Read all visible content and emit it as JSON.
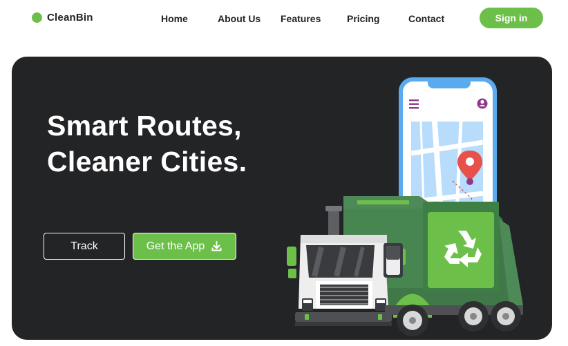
{
  "brand": {
    "name": "CleanBin",
    "accent": "#6cc04a"
  },
  "nav": {
    "links": [
      {
        "label": "Home"
      },
      {
        "label": "About Us"
      },
      {
        "label": "Features"
      },
      {
        "label": "Pricing"
      },
      {
        "label": "Contact"
      }
    ],
    "signin_label": "Sign in"
  },
  "hero": {
    "headline_line1": "Smart Routes,",
    "headline_line2": "Cleaner Cities.",
    "track_label": "Track",
    "app_label": "Get the App",
    "app_icon": "download-icon",
    "background": "#232426"
  },
  "illustration": {
    "phone_icons": [
      "menu-icon",
      "user-icon",
      "map-pin-icon"
    ],
    "truck_icon": "recycle-icon"
  }
}
